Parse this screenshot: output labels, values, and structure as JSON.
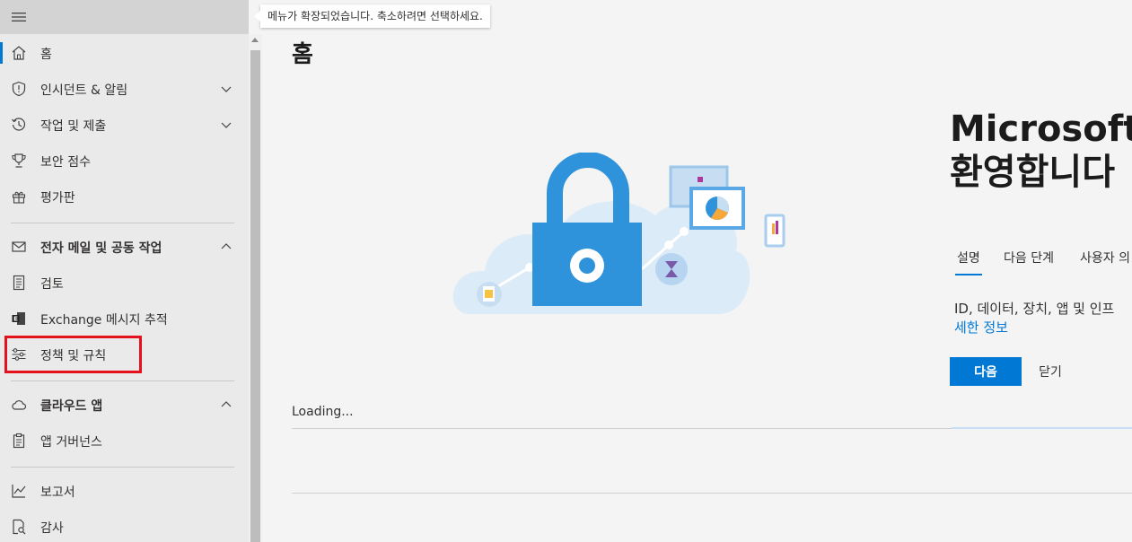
{
  "tooltip": "메뉴가 확장되었습니다. 축소하려면 선택하세요.",
  "nav": {
    "items": [
      {
        "label": "홈",
        "icon": "home-icon"
      },
      {
        "label": "인시던트 & 알림",
        "icon": "shield-icon",
        "chevron": "chevron-down-icon"
      },
      {
        "label": "작업 및 제출",
        "icon": "history-icon",
        "chevron": "chevron-down-icon"
      },
      {
        "label": "보안 점수",
        "icon": "trophy-icon"
      },
      {
        "label": "평가판",
        "icon": "gift-icon"
      },
      {
        "label": "전자 메일 및 공동 작업",
        "icon": "mail-icon",
        "chevron": "chevron-up-icon"
      },
      {
        "label": "검토",
        "icon": "document-icon"
      },
      {
        "label": "Exchange 메시지 추적",
        "icon": "exchange-icon"
      },
      {
        "label": "정책 및 규칙",
        "icon": "sliders-icon"
      },
      {
        "label": "클라우드 앱",
        "icon": "cloud-icon",
        "chevron": "chevron-up-icon"
      },
      {
        "label": "앱 거버넌스",
        "icon": "clipboard-icon"
      },
      {
        "label": "보고서",
        "icon": "chart-line-icon"
      },
      {
        "label": "감사",
        "icon": "search-document-icon"
      }
    ]
  },
  "main": {
    "page_title": "홈",
    "welcome": {
      "line1": "Microsoft",
      "line2": "환영합니다"
    },
    "tabs": [
      "설명",
      "다음 단계",
      "사용자 의"
    ],
    "description": "ID, 데이터, 장치, 앱 및 인프",
    "detail_link": "세한 정보",
    "next_button": "다음",
    "close_button": "닫기",
    "loading": "Loading..."
  },
  "colors": {
    "accent": "#0078d4",
    "highlight": "#e3121c"
  }
}
